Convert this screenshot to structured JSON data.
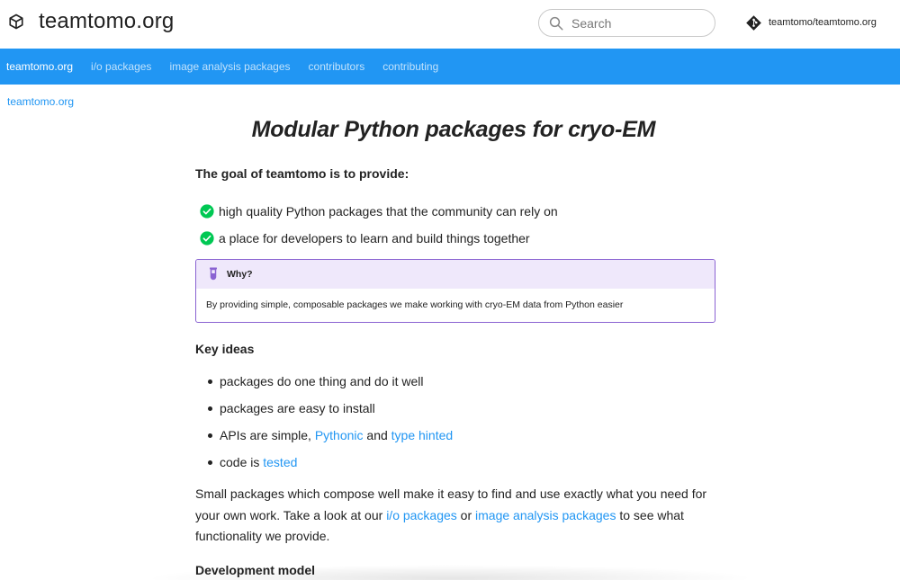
{
  "header": {
    "site_title": "teamtomo.org",
    "search_placeholder": "Search",
    "repo_label": "teamtomo/teamtomo.org"
  },
  "nav": {
    "items": [
      {
        "label": "teamtomo.org",
        "active": true
      },
      {
        "label": "i/o packages",
        "active": false
      },
      {
        "label": "image analysis packages",
        "active": false
      },
      {
        "label": "contributors",
        "active": false
      },
      {
        "label": "contributing",
        "active": false
      }
    ]
  },
  "breadcrumb": "teamtomo.org",
  "main": {
    "title": "Modular Python packages for cryo-EM",
    "goal_heading": "The goal of teamtomo is to provide:",
    "goals": [
      "high quality Python packages that the community can rely on",
      "a place for developers to learn and build things together"
    ],
    "admonition": {
      "title": "Why?",
      "body": "By providing simple, composable packages we make working with cryo-EM data from Python easier"
    },
    "key_ideas_heading": "Key ideas",
    "key_ideas": {
      "item1": "packages do one thing and do it well",
      "item2": "packages are easy to install",
      "item3_prefix": "APIs are simple, ",
      "item3_link1": "Pythonic",
      "item3_mid": " and ",
      "item3_link2": "type hinted",
      "item4_prefix": "code is ",
      "item4_link": "tested"
    },
    "paragraph": {
      "part1": "Small packages which compose well make it easy to find and use exactly what you need for your own work. Take a look at our ",
      "link1": "i/o packages",
      "part2": " or ",
      "link2": "image analysis packages",
      "part3": " to see what functionality we provide."
    },
    "dev_model_heading": "Development model"
  },
  "colors": {
    "nav_bg": "#2196f3",
    "link": "#2196f3",
    "check_green": "#00c853",
    "admonition_border": "#8a63d2",
    "admonition_bg": "#efe8fb"
  },
  "icons": {
    "logo": "cube-icon",
    "search": "search-icon",
    "repo": "git-icon",
    "check": "check-circle-icon",
    "admonition": "flask-icon"
  }
}
